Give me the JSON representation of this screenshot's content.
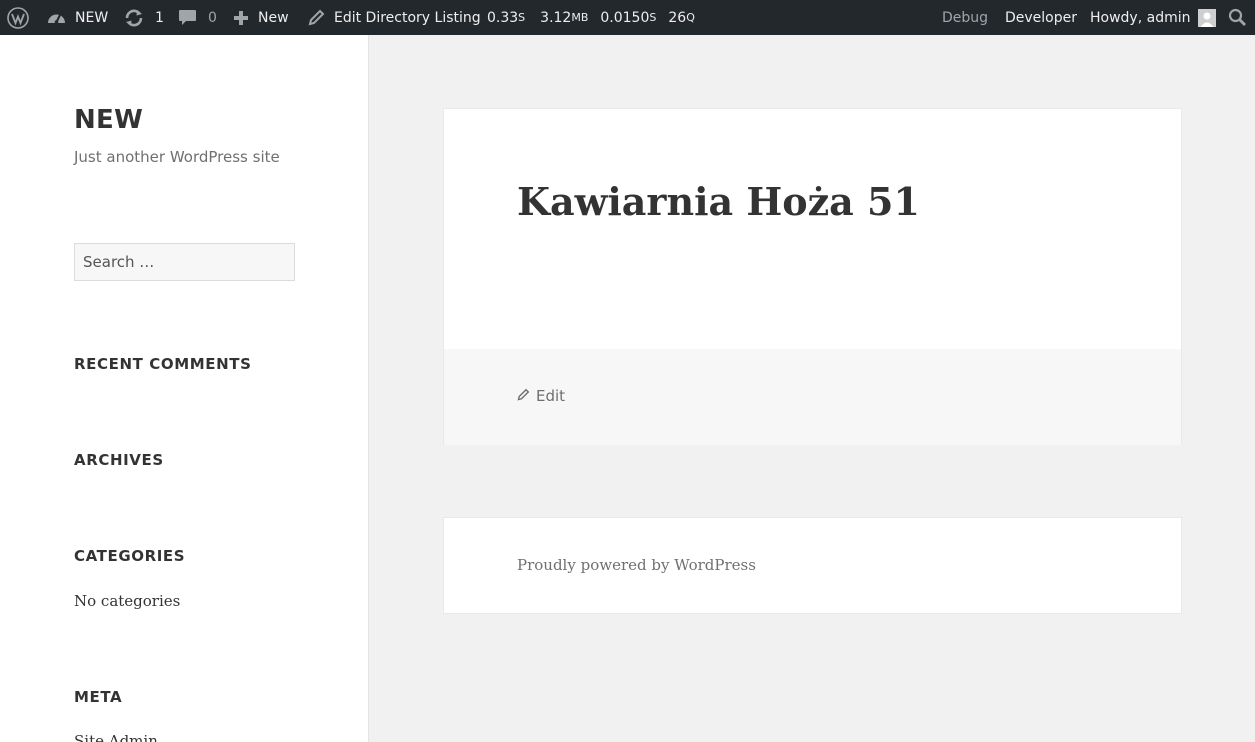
{
  "adminbar": {
    "site_name": "NEW",
    "updates_count": "1",
    "comments_count": "0",
    "new_label": "New",
    "edit_label": "Edit Directory Listing",
    "stats": {
      "time_value": "0.33",
      "time_unit": "S",
      "memory_value": "3.12",
      "memory_unit": "MB",
      "db_time_value": "0.0150",
      "db_time_unit": "S",
      "queries_value": "26",
      "queries_unit": "Q"
    },
    "debug_label": "Debug",
    "developer_label": "Developer",
    "howdy_label": "Howdy, admin"
  },
  "sidebar": {
    "site_title": "NEW",
    "site_description": "Just another WordPress site",
    "search_placeholder": "Search …",
    "recent_comments_title": "RECENT COMMENTS",
    "archives_title": "ARCHIVES",
    "categories_title": "CATEGORIES",
    "categories_empty": "No categories",
    "meta_title": "META",
    "meta_first_link": "Site Admin"
  },
  "post": {
    "title": "Kawiarnia Hoża 51",
    "edit_label": "Edit"
  },
  "footer": {
    "powered_by": "Proudly powered by WordPress"
  }
}
